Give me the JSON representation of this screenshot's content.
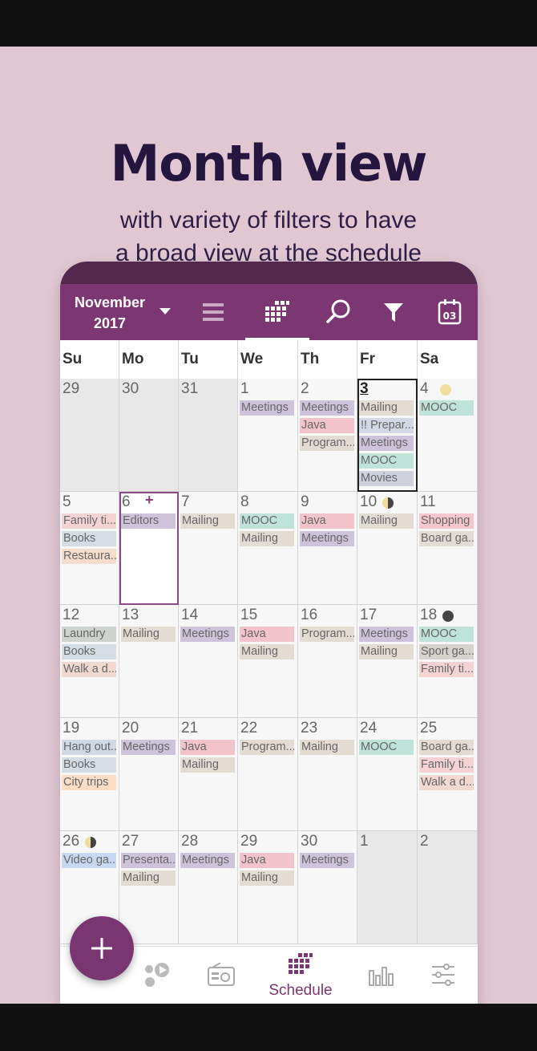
{
  "promo": {
    "headline": "Month view",
    "subline_1": "with variety of filters to have",
    "subline_2": "a broad view at the schedule"
  },
  "toolbar": {
    "month": "November",
    "year": "2017",
    "icons": [
      "list-view-icon",
      "month-grid-icon",
      "search-icon",
      "filter-icon",
      "today-calendar-icon"
    ],
    "today_badge": "03"
  },
  "weekdays": [
    "Su",
    "Mo",
    "Tu",
    "We",
    "Th",
    "Fr",
    "Sa"
  ],
  "event_colors": {
    "Meetings": "#cdc4dc",
    "Java": "#f3c3cb",
    "Program...": "#e3dcd3",
    "Mailing": "#e3dcd3",
    "MOOC": "#bfe3d9",
    "Movies": "#cfd2dd",
    "!! Prepar...": "#d3d7e6",
    "Family ti...": "#f5d3d3",
    "Books": "#d3dde3",
    "Restaura...": "#f6dccb",
    "Editors": "#cdc4dc",
    "Shopping": "#f3c7cd",
    "Board ga...": "#e3dcd3",
    "Laundry": "#cfd3cf",
    "Walk a d...": "#f1d9d0",
    "Sport ga...": "#d6d2cd",
    "Hang out...": "#d0d8e6",
    "City trips": "#fbdcc4",
    "Video ga...": "#c8d7f2",
    "Presenta...": "#cdc4dc"
  },
  "weeks": [
    [
      {
        "day": "29",
        "other": true,
        "events": []
      },
      {
        "day": "30",
        "other": true,
        "events": []
      },
      {
        "day": "31",
        "other": true,
        "events": []
      },
      {
        "day": "1",
        "events": [
          "Meetings"
        ]
      },
      {
        "day": "2",
        "events": [
          "Meetings",
          "Java",
          "Program..."
        ]
      },
      {
        "day": "3",
        "today": true,
        "events": [
          "Mailing",
          "!! Prepar...",
          "Meetings",
          "MOOC",
          "Movies"
        ]
      },
      {
        "day": "4",
        "moon": "full",
        "events": [
          "MOOC"
        ]
      }
    ],
    [
      {
        "day": "5",
        "events": [
          "Family ti...",
          "Books",
          "Restaura..."
        ]
      },
      {
        "day": "6",
        "selected": true,
        "plus": "+",
        "events": [
          "Editors"
        ]
      },
      {
        "day": "7",
        "events": [
          "Mailing"
        ]
      },
      {
        "day": "8",
        "events": [
          "MOOC",
          "Mailing"
        ]
      },
      {
        "day": "9",
        "events": [
          "Java",
          "Meetings"
        ]
      },
      {
        "day": "10",
        "moon": "half",
        "events": [
          "Mailing"
        ]
      },
      {
        "day": "11",
        "events": [
          "Shopping",
          "Board ga..."
        ]
      }
    ],
    [
      {
        "day": "12",
        "events": [
          "Laundry",
          "Books",
          "Walk a d..."
        ]
      },
      {
        "day": "13",
        "events": [
          "Mailing"
        ]
      },
      {
        "day": "14",
        "events": [
          "Meetings"
        ]
      },
      {
        "day": "15",
        "events": [
          "Java",
          "Mailing"
        ]
      },
      {
        "day": "16",
        "events": [
          "Program..."
        ]
      },
      {
        "day": "17",
        "events": [
          "Meetings",
          "Mailing"
        ]
      },
      {
        "day": "18",
        "moon": "new",
        "events": [
          "MOOC",
          "Sport ga...",
          "Family ti..."
        ]
      }
    ],
    [
      {
        "day": "19",
        "events": [
          "Hang out...",
          "Books",
          "City trips"
        ]
      },
      {
        "day": "20",
        "events": [
          "Meetings"
        ]
      },
      {
        "day": "21",
        "events": [
          "Java",
          "Mailing"
        ]
      },
      {
        "day": "22",
        "events": [
          "Program..."
        ]
      },
      {
        "day": "23",
        "events": [
          "Mailing"
        ]
      },
      {
        "day": "24",
        "events": [
          "MOOC"
        ]
      },
      {
        "day": "25",
        "events": [
          "Board ga...",
          "Family ti...",
          "Walk a d..."
        ]
      }
    ],
    [
      {
        "day": "26",
        "moon": "half",
        "events": [
          "Video ga..."
        ]
      },
      {
        "day": "27",
        "events": [
          "Presenta...",
          "Mailing"
        ]
      },
      {
        "day": "28",
        "events": [
          "Meetings"
        ]
      },
      {
        "day": "29",
        "events": [
          "Java",
          "Mailing"
        ]
      },
      {
        "day": "30",
        "events": [
          "Meetings"
        ]
      },
      {
        "day": "1",
        "other": true,
        "events": []
      },
      {
        "day": "2",
        "other": true,
        "events": []
      }
    ]
  ],
  "bottom_nav": {
    "items": [
      {
        "icon": "bubbles-play-icon"
      },
      {
        "icon": "radio-icon"
      },
      {
        "icon": "schedule-grid-icon",
        "label": "Schedule",
        "active": true
      },
      {
        "icon": "bar-chart-icon"
      },
      {
        "icon": "sliders-icon"
      }
    ]
  },
  "fab": {
    "icon": "plus-icon"
  }
}
